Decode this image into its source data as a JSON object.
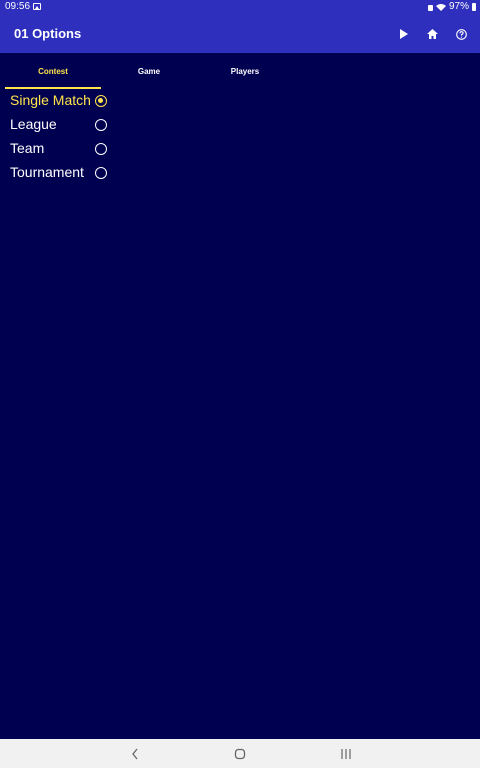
{
  "status_bar": {
    "time": "09:56",
    "battery_text": "97%"
  },
  "app_bar": {
    "title": "01 Options",
    "actions": [
      "play-icon",
      "home-icon",
      "help-icon"
    ]
  },
  "tabs": [
    {
      "label": "Contest",
      "active": true
    },
    {
      "label": "Game",
      "active": false
    },
    {
      "label": "Players",
      "active": false
    }
  ],
  "options": [
    {
      "label": "Single Match",
      "selected": true
    },
    {
      "label": "League",
      "selected": false
    },
    {
      "label": "Team",
      "selected": false
    },
    {
      "label": "Tournament",
      "selected": false
    }
  ],
  "colors": {
    "app_bar": "#2e2fbd",
    "background": "#000050",
    "accent": "#ffe44a",
    "text": "#ffffff",
    "nav_bar": "#f1f1f1"
  },
  "nav_bar": {
    "buttons": [
      "back-icon",
      "home-circle-icon",
      "recents-icon"
    ]
  }
}
